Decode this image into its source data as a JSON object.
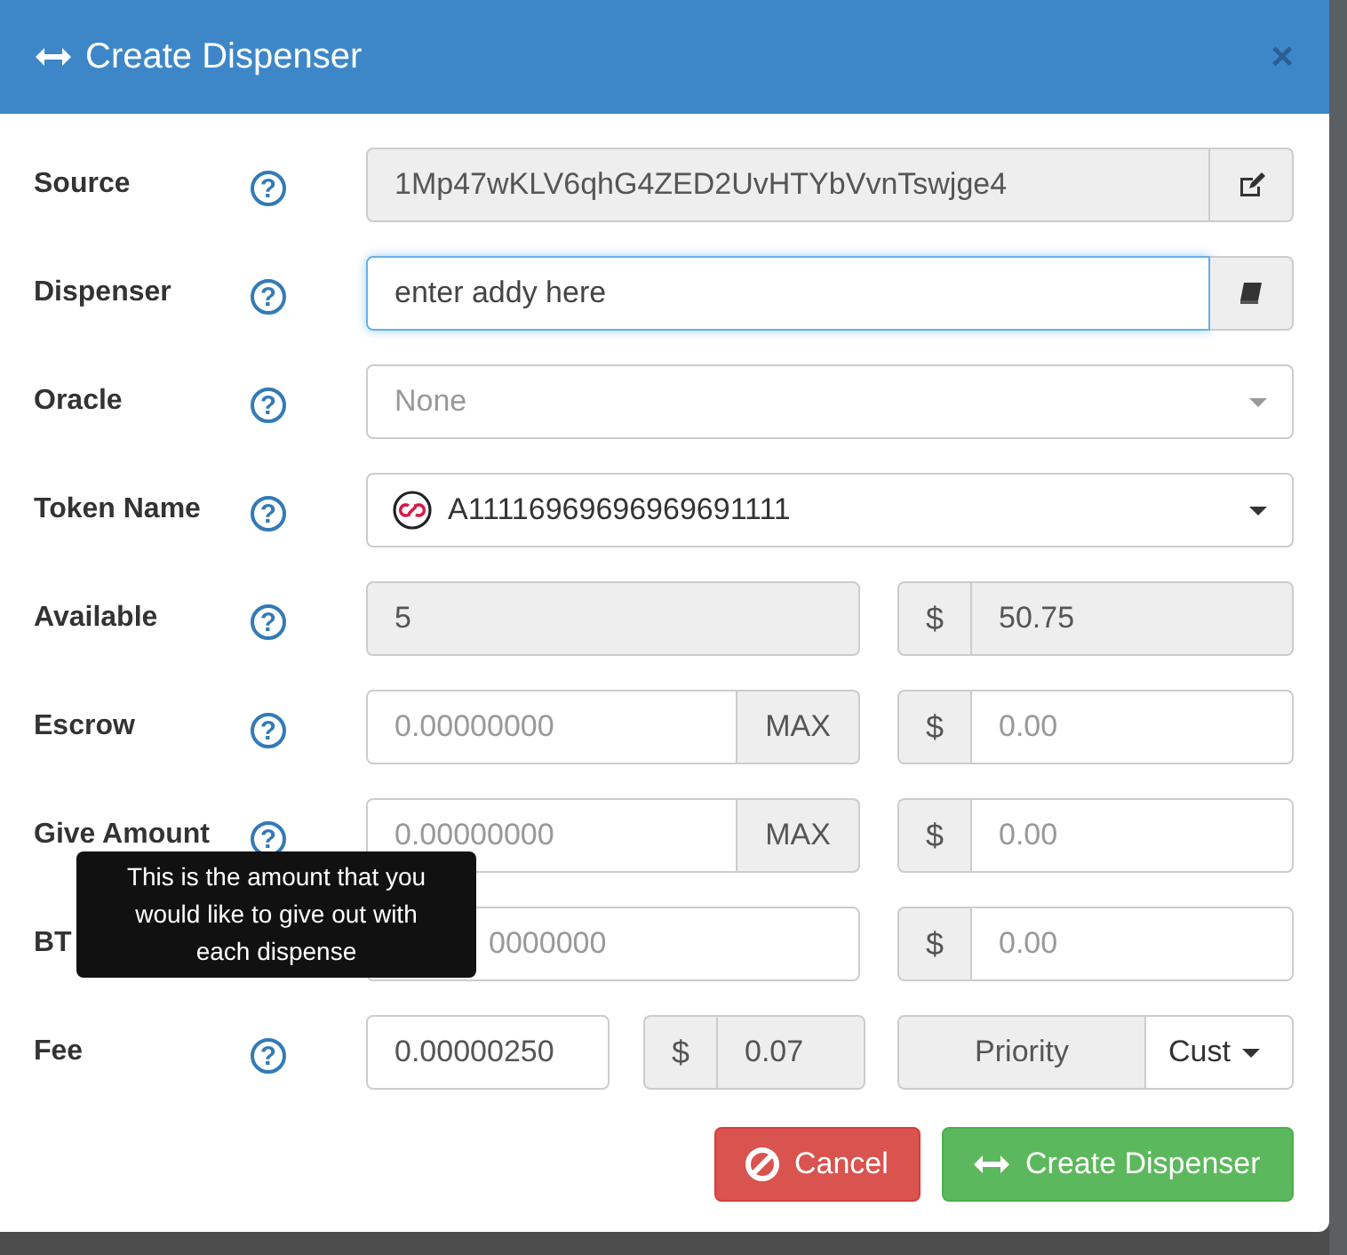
{
  "modal": {
    "title": "Create Dispenser",
    "close": "×"
  },
  "fields": [
    {
      "label": "Source",
      "help": "?",
      "kind": "edit",
      "value": "1Mp47wKLV6qhG4ZED2UvHTYbVvnTswjge4",
      "readonly": true,
      "focused": false
    },
    {
      "label": "Dispenser",
      "help": "?",
      "kind": "book",
      "value": "enter addy here",
      "readonly": false,
      "focused": true
    },
    {
      "label": "Oracle",
      "help": "?",
      "kind": "select",
      "placeholder": "None"
    },
    {
      "label": "Token Name",
      "help": "?",
      "kind": "token",
      "value": "A11116969696969691111"
    },
    {
      "label": "Available",
      "help": "?",
      "kind": "pair",
      "readonly": true,
      "amount": {
        "value": "5"
      },
      "currency": "$",
      "usd": {
        "value": "50.75"
      }
    },
    {
      "label": "Escrow",
      "help": "?",
      "kind": "pair",
      "readonly": false,
      "amount": {
        "placeholder": "0.00000000",
        "max": "MAX"
      },
      "currency": "$",
      "usd": {
        "placeholder": "0.00"
      }
    },
    {
      "label": "Give Amount",
      "help": "?",
      "kind": "pair",
      "readonly": false,
      "amount": {
        "placeholder": "0.00000000",
        "max": "MAX"
      },
      "currency": "$",
      "usd": {
        "placeholder": "0.00"
      },
      "tooltip": "This is the amount that you would like to give out with each dispense"
    },
    {
      "label": "BT",
      "kind": "pair",
      "readonly": false,
      "covered": true,
      "amount": {
        "placeholder": "0000000"
      },
      "currency": "$",
      "usd": {
        "placeholder": "0.00"
      }
    },
    {
      "label": "Fee",
      "help": "?",
      "kind": "fee",
      "value": "0.00000250",
      "currency": "$",
      "usd": "0.07",
      "priority": "Priority",
      "speed": "Cust"
    }
  ],
  "buttons": [
    {
      "label": "Cancel",
      "kind": "cancel"
    },
    {
      "label": "Create Dispenser",
      "kind": "primary"
    }
  ]
}
